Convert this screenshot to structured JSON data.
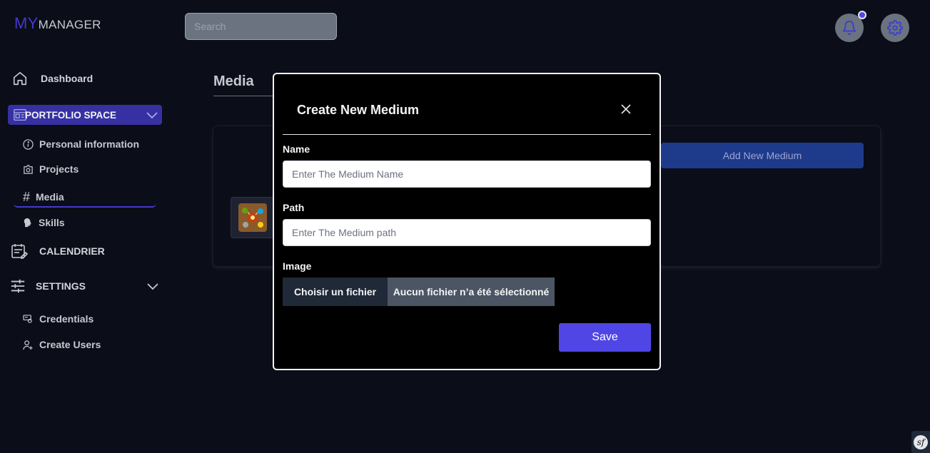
{
  "app": {
    "logo_prefix": "MY",
    "logo_suffix": "MANAGER"
  },
  "header": {
    "search_placeholder": "Search"
  },
  "sidebar": {
    "dashboard": "Dashboard",
    "portfolio_space": "PORTFOLIO SPACE",
    "portfolio_items": [
      "Personal information",
      "Projects",
      "Media",
      "Skills"
    ],
    "calendar": "CALENDRIER",
    "settings": "SETTINGS",
    "settings_items": [
      "Credentials",
      "Create Users"
    ]
  },
  "main": {
    "title": "Media",
    "add_button": "Add New Medium"
  },
  "modal": {
    "title": "Create New Medium",
    "name_label": "Name",
    "name_placeholder": "Enter The Medium Name",
    "path_label": "Path",
    "path_placeholder": "Enter The Medium path",
    "image_label": "Image",
    "file_button": "Choisir un fichier",
    "file_status": "Aucun fichier n’a été sélectionné",
    "save_button": "Save"
  },
  "colors": {
    "background": "#0b0d18",
    "accent": "#4f46e5",
    "portfolio_bg": "#3730a3",
    "add_button_bg": "#1e3a8a"
  }
}
